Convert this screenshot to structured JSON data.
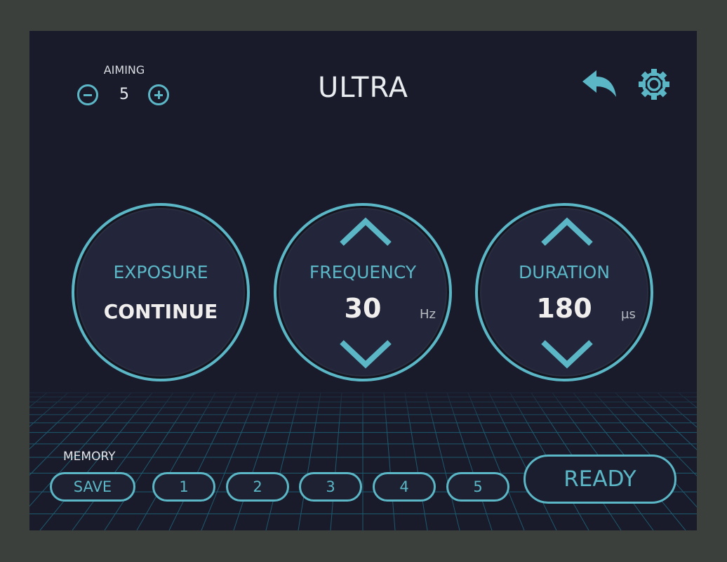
{
  "header": {
    "title": "ULTRA"
  },
  "aiming": {
    "label": "AIMING",
    "value": "5"
  },
  "icons": {
    "back": "back-arrow-icon",
    "settings": "gear-icon"
  },
  "dials": {
    "exposure": {
      "label": "EXPOSURE",
      "value": "CONTINUE"
    },
    "frequency": {
      "label": "FREQUENCY",
      "value": "30",
      "unit": "Hz"
    },
    "duration": {
      "label": "DURATION",
      "value": "180",
      "unit": "µs"
    }
  },
  "memory": {
    "label": "MEMORY",
    "save_label": "SAVE",
    "slots": [
      "1",
      "2",
      "3",
      "4",
      "5"
    ]
  },
  "ready_label": "READY",
  "colors": {
    "accent": "#5bb6c6",
    "background": "#191b2b",
    "bezel": "#3b403d"
  }
}
